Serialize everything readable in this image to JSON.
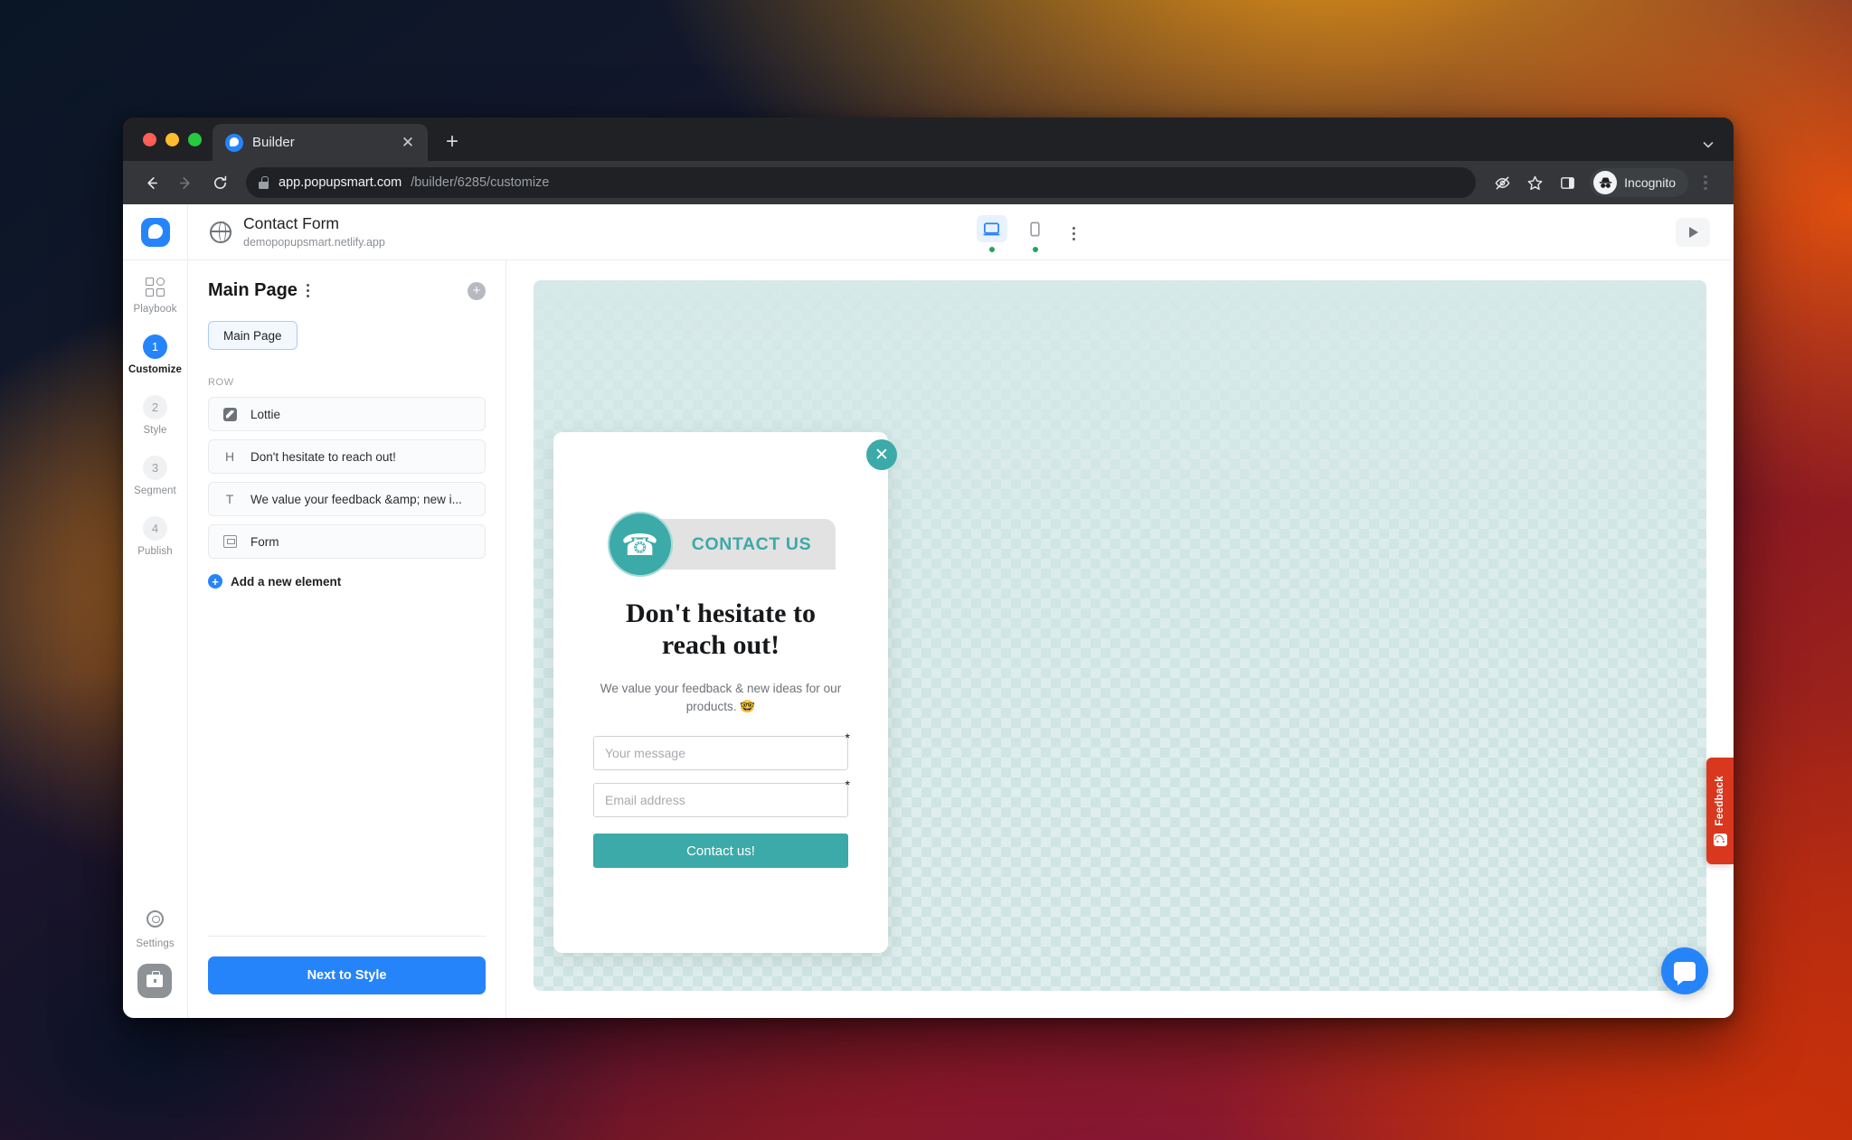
{
  "browser": {
    "tab": {
      "title": "Builder",
      "favicon_icon": "popupsmart-logo-icon",
      "close_icon": "close-icon"
    },
    "new_tab_icon": "plus-icon",
    "tabstrip_chevron_icon": "chevron-down-icon",
    "nav": {
      "back_icon": "arrow-left-icon",
      "forward_icon": "arrow-right-icon",
      "reload_icon": "reload-icon"
    },
    "omnibox": {
      "lock_icon": "lock-icon",
      "url_host": "app.popupsmart.com",
      "url_path": "/builder/6285/customize"
    },
    "toolbar_icons": {
      "tracking_protection": "eye-slash-icon",
      "bookmark": "star-icon",
      "side_panel": "sidebar-panel-icon",
      "profile": "incognito-avatar-icon",
      "menu": "three-dot-menu-icon"
    },
    "incognito_label": "Incognito"
  },
  "app": {
    "logo_icon": "popupsmart-logo-icon",
    "project": {
      "globe_icon": "globe-icon",
      "name": "Contact Form",
      "domain": "demopopupsmart.netlify.app"
    },
    "device_toggle": {
      "desktop": {
        "icon": "desktop-monitor-icon",
        "status_dot": "green",
        "active": "true"
      },
      "mobile": {
        "icon": "mobile-phone-icon",
        "status_dot": "green",
        "active": "false"
      },
      "more_icon": "three-dot-menu-icon"
    },
    "preview_button_icon": "play-icon"
  },
  "rail": {
    "items": [
      {
        "label": "Playbook",
        "icon": "grid-layout-icon",
        "active": "false"
      },
      {
        "label": "Customize",
        "step": "1",
        "active": "true"
      },
      {
        "label": "Style",
        "step": "2",
        "active": "false"
      },
      {
        "label": "Segment",
        "step": "3",
        "active": "false"
      },
      {
        "label": "Publish",
        "step": "4",
        "active": "false"
      }
    ],
    "settings": {
      "label": "Settings",
      "icon": "gear-icon"
    },
    "workspace_icon": "briefcase-icon"
  },
  "panel": {
    "title": "Main Page",
    "title_menu_icon": "three-dot-menu-icon",
    "add_page_icon": "plus-circle-icon",
    "page_chip": "Main Page",
    "row_label": "ROW",
    "elements": [
      {
        "label": "Lottie",
        "icon": "lottie-animation-icon"
      },
      {
        "label": "Don't hesitate to reach out!",
        "icon": "heading-icon"
      },
      {
        "label": "We value your feedback &amp; new i...",
        "icon": "text-icon"
      },
      {
        "label": "Form",
        "icon": "form-icon"
      }
    ],
    "add_element": {
      "label": "Add a new element",
      "icon": "plus-circle-icon"
    },
    "next_button": "Next to Style"
  },
  "popup": {
    "close_icon": "close-icon",
    "lottie_badge": {
      "phone_icon": "phone-icon",
      "label": "CONTACT US"
    },
    "heading": "Don't hesitate to reach out!",
    "paragraph": "We value your feedback & new ideas for our products. 🤓",
    "fields": [
      {
        "placeholder": "Your message",
        "value": "",
        "required_marker": "*"
      },
      {
        "placeholder": "Email address",
        "value": "",
        "required_marker": "*"
      }
    ],
    "submit_label": "Contact us!"
  },
  "overlays": {
    "feedback_tab": {
      "label": "Feedback",
      "icon": "smiley-face-icon"
    },
    "chat_button_icon": "chat-bubble-icon"
  },
  "colors": {
    "brand_blue": "#2684fb",
    "popup_teal": "#3caaa8",
    "feedback_red": "#d9381e",
    "canvas_teal": "#cfe5e4"
  }
}
